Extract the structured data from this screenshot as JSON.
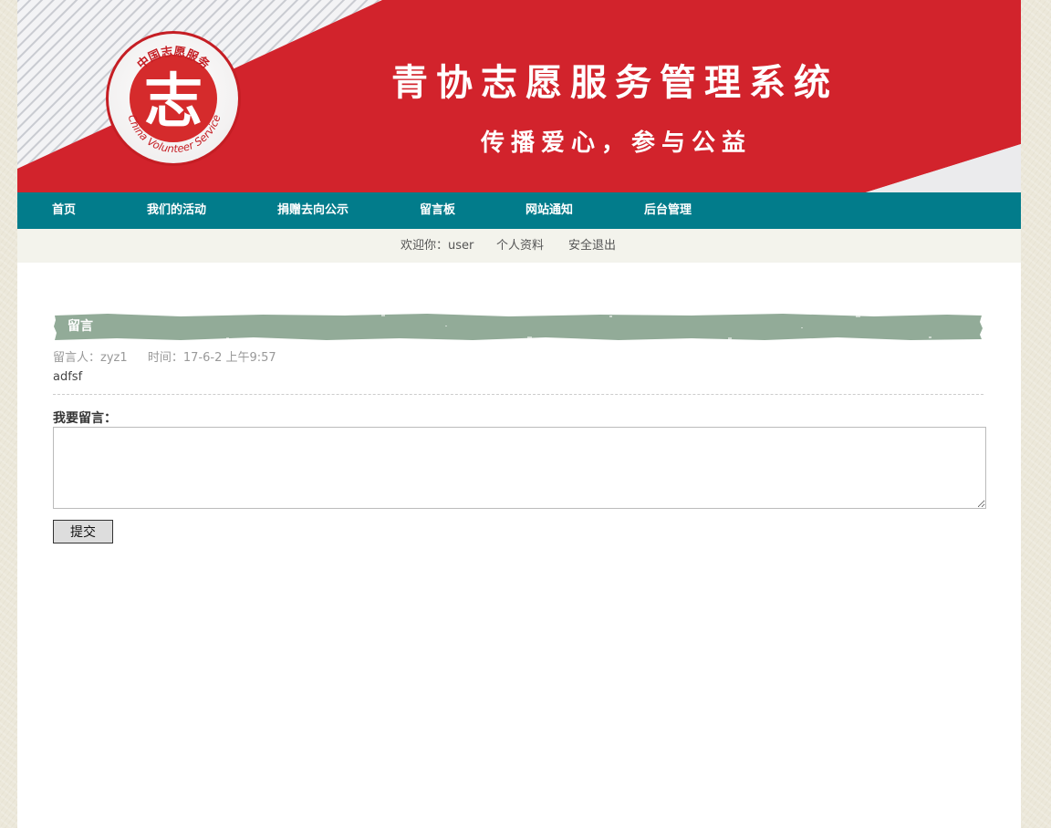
{
  "banner": {
    "title": "青协志愿服务管理系统",
    "subtitle": "传播爱心，参与公益",
    "logo_top_text": "中国志愿服务",
    "logo_bottom_text": "China Volunteer Service",
    "logo_glyph": "志"
  },
  "nav": {
    "items": [
      {
        "label": "首页"
      },
      {
        "label": "我们的活动"
      },
      {
        "label": "捐赠去向公示"
      },
      {
        "label": "留言板"
      },
      {
        "label": "网站通知"
      },
      {
        "label": "后台管理"
      }
    ]
  },
  "userbar": {
    "welcome": "欢迎你：user",
    "profile": "个人资料",
    "logout": "安全退出"
  },
  "section": {
    "title": "留言"
  },
  "message": {
    "author": "留言人：zyz1",
    "time": "时间：17-6-2 上午9:57",
    "content": "adfsf"
  },
  "form": {
    "label": "我要留言：",
    "value": "",
    "submit_label": "提交"
  },
  "colors": {
    "banner_red": "#d2232c",
    "nav_teal": "#027c8b",
    "section_header": "#92ab98",
    "userbar_bg": "#f3f3ec"
  }
}
